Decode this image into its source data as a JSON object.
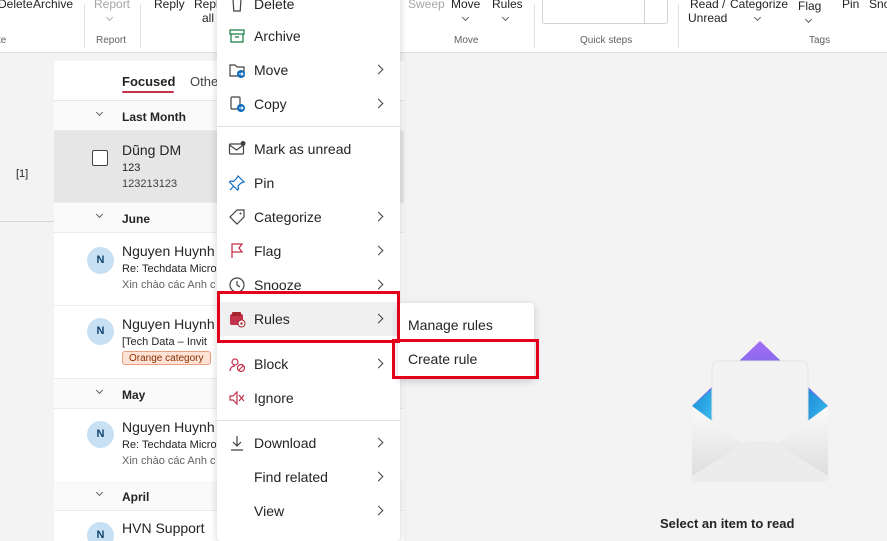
{
  "ribbon": {
    "delete_label": "Delete",
    "archive_label": "Archive",
    "report_label": "Report",
    "report_group": "Report",
    "reply_label": "Reply",
    "reply_all_line1": "Reply",
    "reply_all_line2": "all",
    "sweep_label": "Sweep",
    "move_label": "Move",
    "rules_label": "Rules",
    "move_group": "Move",
    "quick_steps_group": "Quick steps",
    "read_unread_line1": "Read /",
    "read_unread_line2": "Unread",
    "categorize_label": "Categorize",
    "flag_label": "Flag",
    "pin_label": "Pin",
    "snooze_label": "Sno",
    "tags_group": "Tags",
    "left_group_fragment": "te"
  },
  "leftnav": {
    "count": "[1]"
  },
  "list": {
    "tab_focused": "Focused",
    "tab_other": "Othe",
    "groups": [
      {
        "label": "Last Month"
      },
      {
        "label": "June"
      },
      {
        "label": "May"
      },
      {
        "label": "April"
      }
    ],
    "items": [
      {
        "sender": "Dũng DM",
        "subject": "123",
        "preview": "123213123"
      },
      {
        "initial": "N",
        "sender": "Nguyen Huynh",
        "subject": "Re: Techdata Micro",
        "preview": "Xin chào các Anh c"
      },
      {
        "initial": "N",
        "sender": "Nguyen Huynh",
        "subject": "[Tech Data – Invit",
        "badge": "Orange category"
      },
      {
        "initial": "N",
        "sender": "Nguyen Huynh",
        "subject": "Re: Techdata Micro",
        "preview": "Xin chào các Anh c"
      },
      {
        "initial": "N",
        "sender": "HVN Support"
      }
    ]
  },
  "context_menu": {
    "items": [
      {
        "label": "Delete",
        "icon": "trash-icon"
      },
      {
        "label": "Archive",
        "icon": "archive-icon"
      },
      {
        "label": "Move",
        "icon": "move-folder-icon"
      },
      {
        "label": "Copy",
        "icon": "copy-icon"
      },
      {
        "label": "Mark as unread",
        "icon": "mail-unread-icon"
      },
      {
        "label": "Pin",
        "icon": "pin-icon"
      },
      {
        "label": "Categorize",
        "icon": "tag-icon"
      },
      {
        "label": "Flag",
        "icon": "flag-icon"
      },
      {
        "label": "Snooze",
        "icon": "clock-icon"
      },
      {
        "label": "Rules",
        "icon": "rules-icon"
      },
      {
        "label": "Block",
        "icon": "block-icon"
      },
      {
        "label": "Ignore",
        "icon": "ignore-icon"
      },
      {
        "label": "Download",
        "icon": "download-icon"
      },
      {
        "label": "Find related"
      },
      {
        "label": "View"
      }
    ]
  },
  "submenu": {
    "manage_rules": "Manage rules",
    "create_rule": "Create rule"
  },
  "reading": {
    "empty_message": "Select an item to read"
  },
  "colors": {
    "accent": "#c4314b",
    "highlight": "#e3001b",
    "avatar_bg": "#c7e0f4"
  }
}
